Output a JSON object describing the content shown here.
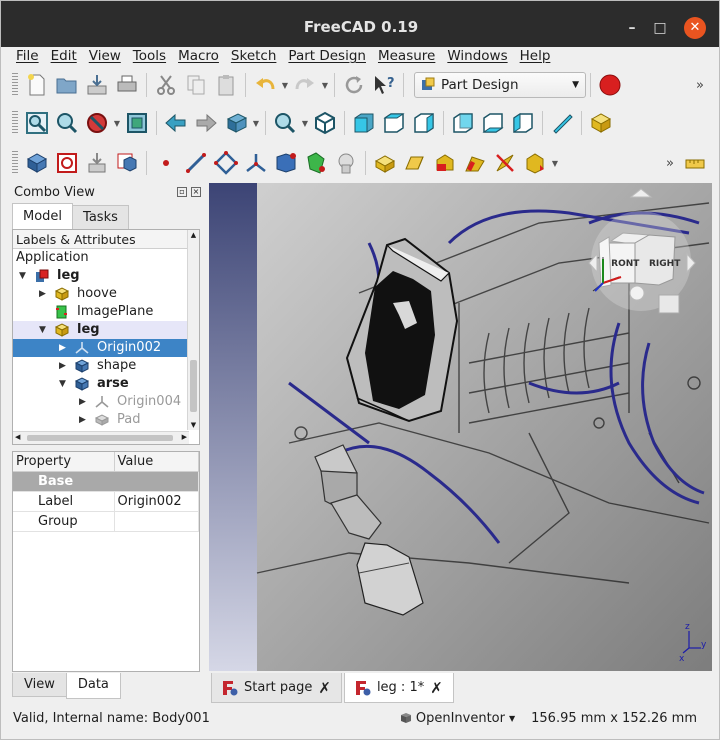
{
  "app": {
    "title": "FreeCAD 0.19",
    "window_controls": {
      "minimize": "–",
      "maximize": "□",
      "close": "✕"
    }
  },
  "menubar": {
    "items": [
      "File",
      "Edit",
      "View",
      "Tools",
      "Macro",
      "Sketch",
      "Part Design",
      "Measure",
      "Windows",
      "Help"
    ]
  },
  "toolbar": {
    "workbench": "Part Design",
    "overflow": "»",
    "row1_icons": [
      "new-document-icon",
      "open-icon",
      "import-icon",
      "print-icon",
      "cut-icon",
      "copy-icon",
      "paste-icon",
      "undo-icon",
      "redo-icon",
      "refresh-icon",
      "whats-this-icon",
      "workbench-icon",
      "record-macro-icon"
    ],
    "row2_icons": [
      "fit-all-icon",
      "fit-selection-icon",
      "draw-style-icon",
      "bounding-box-icon",
      "back-icon",
      "forward-icon",
      "sync-view-icon",
      "zoom-icon",
      "isometric-icon",
      "front-view-icon",
      "top-view-icon",
      "right-view-icon",
      "rear-view-icon",
      "bottom-view-icon",
      "left-view-icon",
      "measure-icon",
      "part-icon"
    ],
    "row3_icons": [
      "body-icon",
      "create-sketch-icon",
      "validate-sketch-icon",
      "clone-icon",
      "datum-point-icon",
      "datum-line-icon",
      "datum-plane-icon",
      "local-cs-icon",
      "shape-binder-icon",
      "subshape-binder-icon",
      "clone-cs-icon",
      "pad-icon",
      "revolution-icon",
      "additive-loft-icon",
      "additive-pipe-icon",
      "additive-helix-icon",
      "additive-box-icon",
      "measure-linear-icon"
    ]
  },
  "combo": {
    "title": "Combo View",
    "tabs": [
      "Model",
      "Tasks"
    ],
    "active_tab": "Model",
    "tree": {
      "header": "Labels & Attributes",
      "rows": [
        {
          "label": "Application",
          "bold": false
        },
        {
          "label": "leg",
          "bold": true
        },
        {
          "label": "hoove",
          "bold": false
        },
        {
          "label": "ImagePlane",
          "bold": false
        },
        {
          "label": "leg",
          "bold": true
        },
        {
          "label": "Origin002",
          "bold": false,
          "selected": true
        },
        {
          "label": "shape",
          "bold": false
        },
        {
          "label": "arse",
          "bold": true
        },
        {
          "label": "Origin004",
          "bold": false,
          "dim": true
        },
        {
          "label": "Pad",
          "bold": false,
          "dim": true
        }
      ]
    },
    "properties": {
      "columns": [
        "Property",
        "Value"
      ],
      "group": "Base",
      "rows": [
        {
          "key": "Label",
          "value": "Origin002"
        },
        {
          "key": "Group",
          "value": ""
        }
      ]
    },
    "bottom_tabs": [
      "View",
      "Data"
    ],
    "active_bottom_tab": "Data"
  },
  "viewport": {
    "navcube_faces": [
      "FRONT",
      "RIGHT"
    ],
    "axis_labels": [
      "x",
      "y",
      "z"
    ]
  },
  "documents": {
    "tabs": [
      {
        "label": "Start page",
        "active": false
      },
      {
        "label": "leg : 1*",
        "active": true
      }
    ],
    "close_glyph": "✗"
  },
  "status": {
    "message": "Valid, Internal name: Body001",
    "nav_style": "OpenInventor",
    "dimensions": "156.95 mm x 152.26 mm"
  },
  "colors": {
    "accent_selection": "#3d84c6",
    "titlebar": "#2c2c2c",
    "close_button": "#e95420",
    "sketch_lines": "#2a2a8c"
  }
}
